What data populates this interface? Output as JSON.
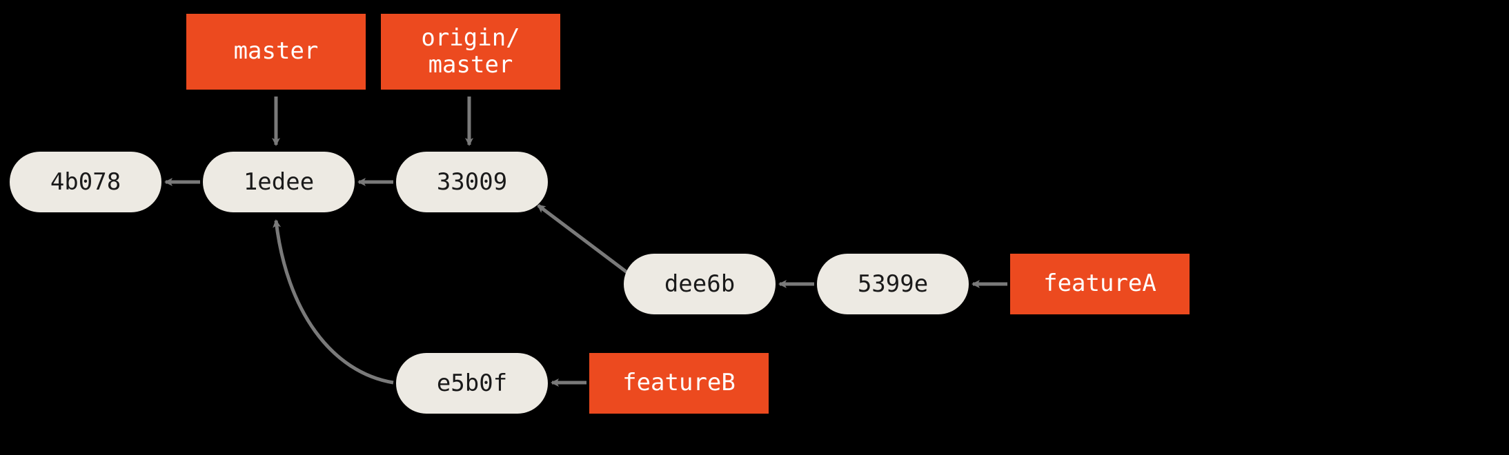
{
  "commits": {
    "c1": "4b078",
    "c2": "1edee",
    "c3": "33009",
    "c4": "dee6b",
    "c5": "5399e",
    "c6": "e5b0f"
  },
  "branches": {
    "master": "master",
    "origin_master": "origin/\nmaster",
    "featureA": "featureA",
    "featureB": "featureB"
  },
  "edges": [
    {
      "from": "c2",
      "to": "c1",
      "type": "parent"
    },
    {
      "from": "c3",
      "to": "c2",
      "type": "parent"
    },
    {
      "from": "c4",
      "to": "c3",
      "type": "parent"
    },
    {
      "from": "c5",
      "to": "c4",
      "type": "parent"
    },
    {
      "from": "c6",
      "to": "c2",
      "type": "parent"
    },
    {
      "from": "master",
      "to": "c2",
      "type": "ref"
    },
    {
      "from": "origin_master",
      "to": "c3",
      "type": "ref"
    },
    {
      "from": "featureA",
      "to": "c5",
      "type": "ref"
    },
    {
      "from": "featureB",
      "to": "c6",
      "type": "ref"
    }
  ]
}
